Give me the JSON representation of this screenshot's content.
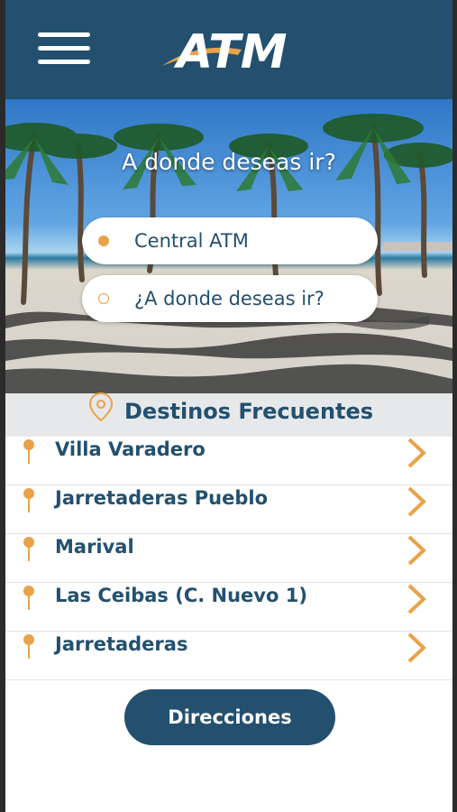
{
  "header": {
    "menu_icon": "hamburger-menu-icon",
    "logo_text": "ATM",
    "background_color": "#23506f"
  },
  "hero": {
    "title": "A donde deseas ir?",
    "origin_value": "Central ATM",
    "destination_placeholder": "¿A donde deseas ir?"
  },
  "frequent": {
    "icon": "location-pin-icon",
    "title": "Destinos Frecuentes",
    "items": [
      {
        "label": "Villa Varadero"
      },
      {
        "label": "Jarretaderas Pueblo"
      },
      {
        "label": "Marival"
      },
      {
        "label": "Las Ceibas (C. Nuevo 1)"
      },
      {
        "label": "Jarretaderas"
      }
    ]
  },
  "actions": {
    "directions_label": "Direcciones"
  },
  "colors": {
    "primary": "#23506f",
    "accent": "#e9a24a"
  }
}
